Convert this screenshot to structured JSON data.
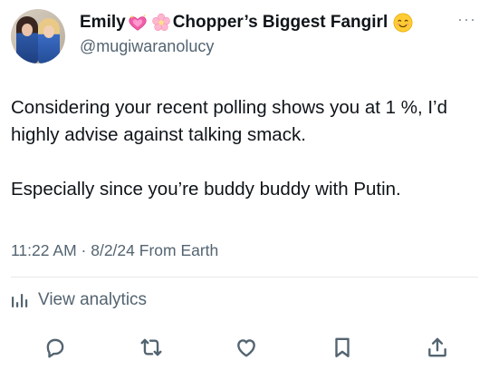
{
  "author": {
    "display_name_part1": "Emily",
    "display_name_part2": "Chopper’s Biggest Fangirl",
    "handle": "@mugiwaranolucy",
    "emojis": [
      "sparkling-heart",
      "cherry-blossom",
      "smiling-face"
    ]
  },
  "more_label": "···",
  "tweet": {
    "paragraph1": "Considering your recent polling shows you at 1 %, I’d highly advise against talking smack.",
    "paragraph2": "Especially since you’re buddy buddy with Putin."
  },
  "meta": {
    "time": "11:22 AM",
    "separator": "·",
    "date": "8/2/24",
    "source": "From Earth"
  },
  "analytics": {
    "label": "View analytics"
  },
  "actions": [
    "reply-icon",
    "retweet-icon",
    "like-icon",
    "bookmark-icon",
    "share-icon"
  ],
  "colors": {
    "text_primary": "#0f1419",
    "text_secondary": "#536471",
    "icon": "#536471",
    "divider": "#e6e9eb"
  }
}
